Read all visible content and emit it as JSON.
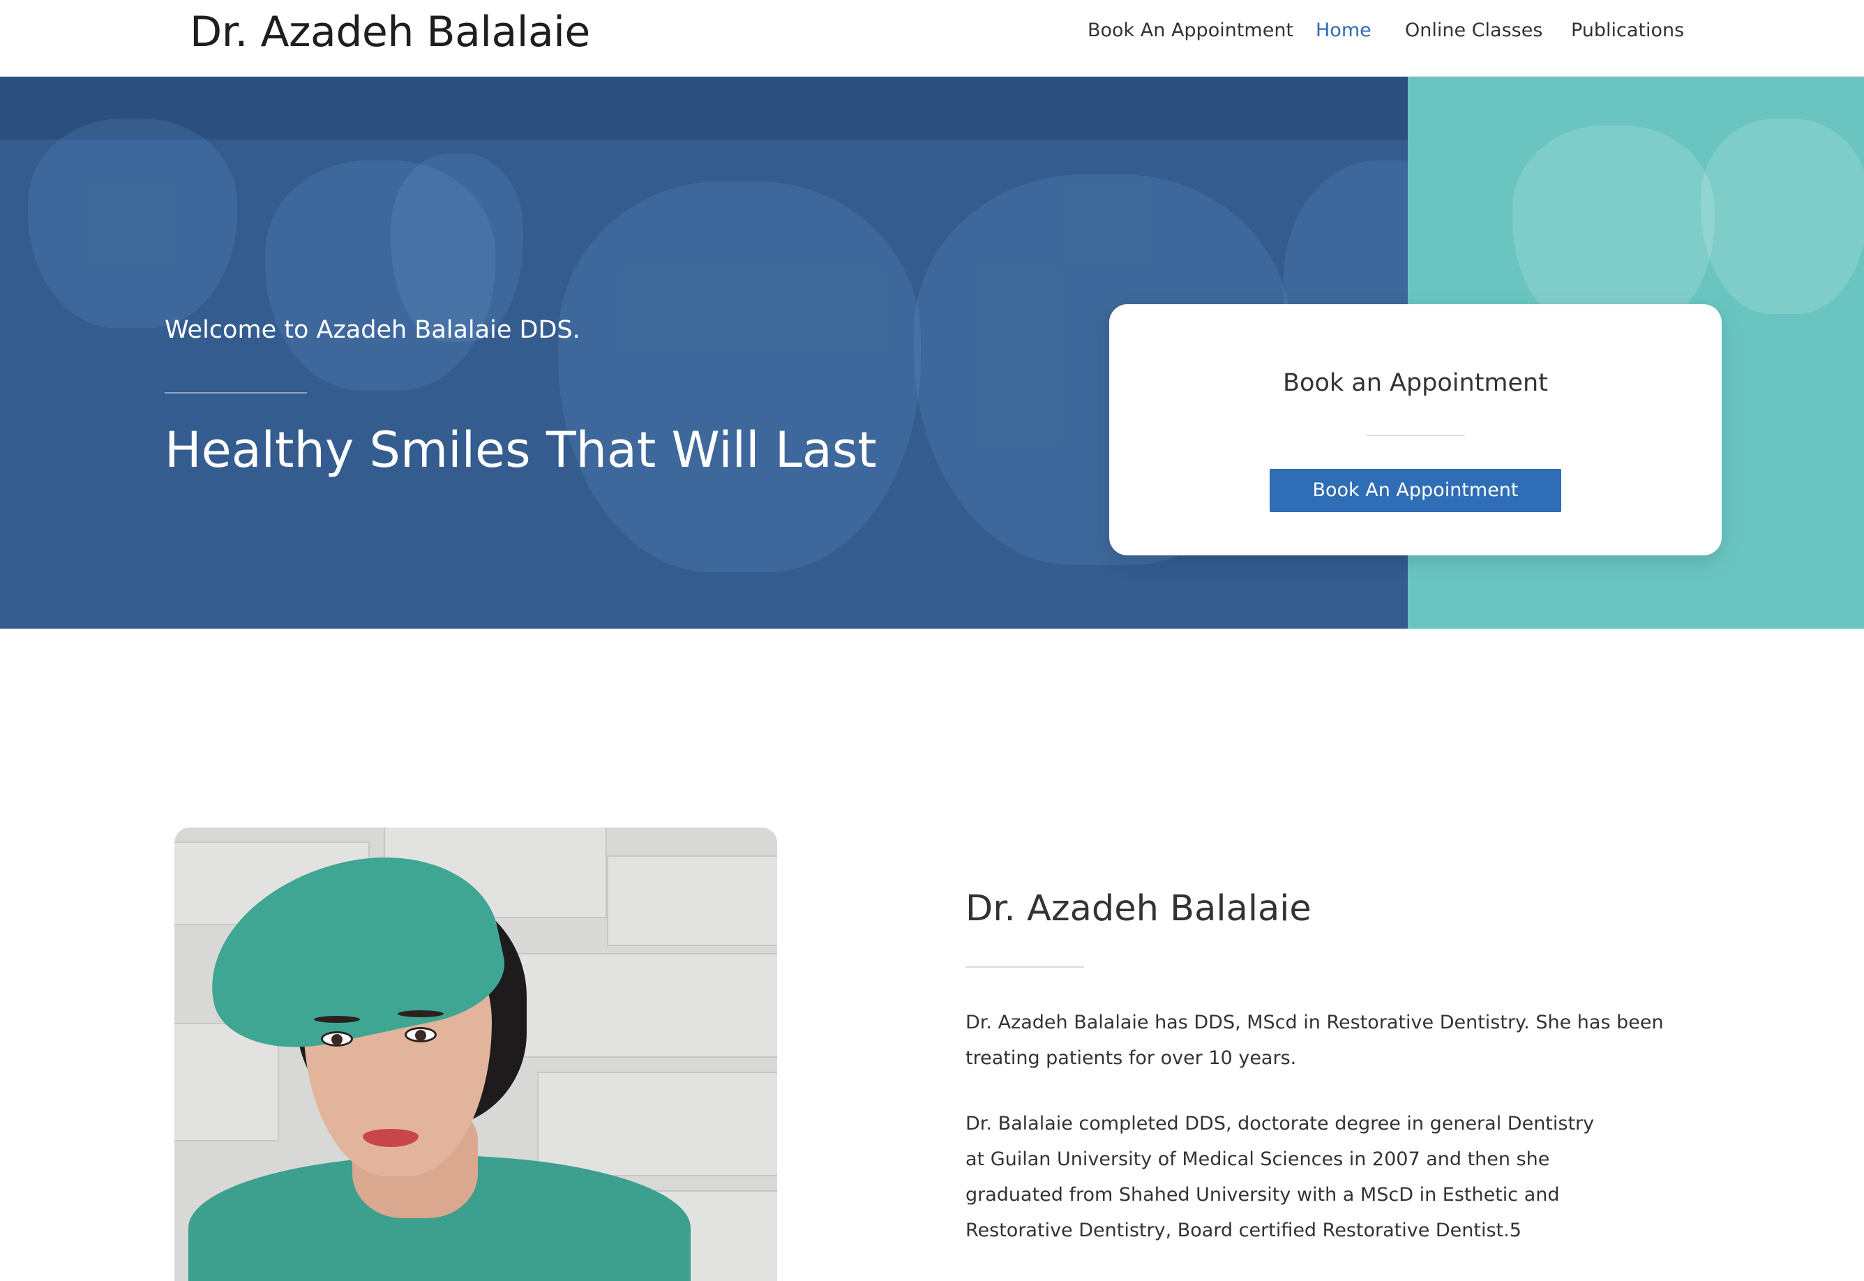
{
  "header": {
    "brand": "Dr. Azadeh Balalaie",
    "nav": [
      {
        "label": "Book An Appointment",
        "active": false
      },
      {
        "label": "Home",
        "active": true
      },
      {
        "label": "Online Classes",
        "active": false
      },
      {
        "label": "Publications",
        "active": false
      }
    ]
  },
  "hero": {
    "welcome": "Welcome to Azadeh Balalaie DDS.",
    "title": "Healthy Smiles That Will Last",
    "card": {
      "title": "Book an Appointment",
      "button_label": "Book An Appointment"
    }
  },
  "about": {
    "title": "Dr. Azadeh Balalaie",
    "paragraph1": [
      "Dr. Azadeh Balalaie has DDS, MScd in Restorative Dentistry. She has been",
      "treating patients for over 10 years."
    ],
    "paragraph2": [
      "Dr. Balalaie completed DDS, doctorate degree in general Dentistry",
      "at Guilan University of Medical Sciences in 2007 and then she",
      "graduated from Shahed University with a MScD in Esthetic and",
      "Restorative Dentistry, Board certified Restorative Dentist.5"
    ]
  },
  "colors": {
    "accent": "#2e6db4",
    "hero_blue": "#345c8f",
    "hero_teal": "#6ac5c1",
    "button": "#2f6db6"
  }
}
